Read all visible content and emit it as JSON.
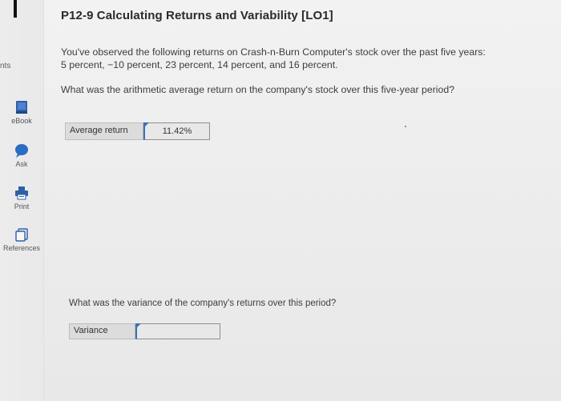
{
  "left_rail": {
    "pts_label": "nts",
    "items": [
      {
        "label": "eBook",
        "icon": "ebook-icon"
      },
      {
        "label": "Ask",
        "icon": "chat-bubble-icon"
      },
      {
        "label": "Print",
        "icon": "printer-icon"
      },
      {
        "label": "References",
        "icon": "references-icon"
      }
    ]
  },
  "problem": {
    "title": "P12-9 Calculating Returns and Variability [LO1]",
    "intro": "You've observed the following returns on Crash-n-Burn Computer's stock over the past five years: 5 percent, −10 percent, 23 percent, 14 percent, and 16 percent.",
    "question1": "What was the arithmetic average return on the company's stock over this five-year period?",
    "answer1": {
      "label": "Average return",
      "value": "11.42%"
    },
    "question2": "What was the variance of the company's returns over this period?",
    "answer2": {
      "label": "Variance",
      "value": ""
    }
  },
  "colors": {
    "accent_blue": "#3b6fb6",
    "ebook_icon": "#2f5fa8",
    "ask_icon": "#2b6cc4"
  }
}
